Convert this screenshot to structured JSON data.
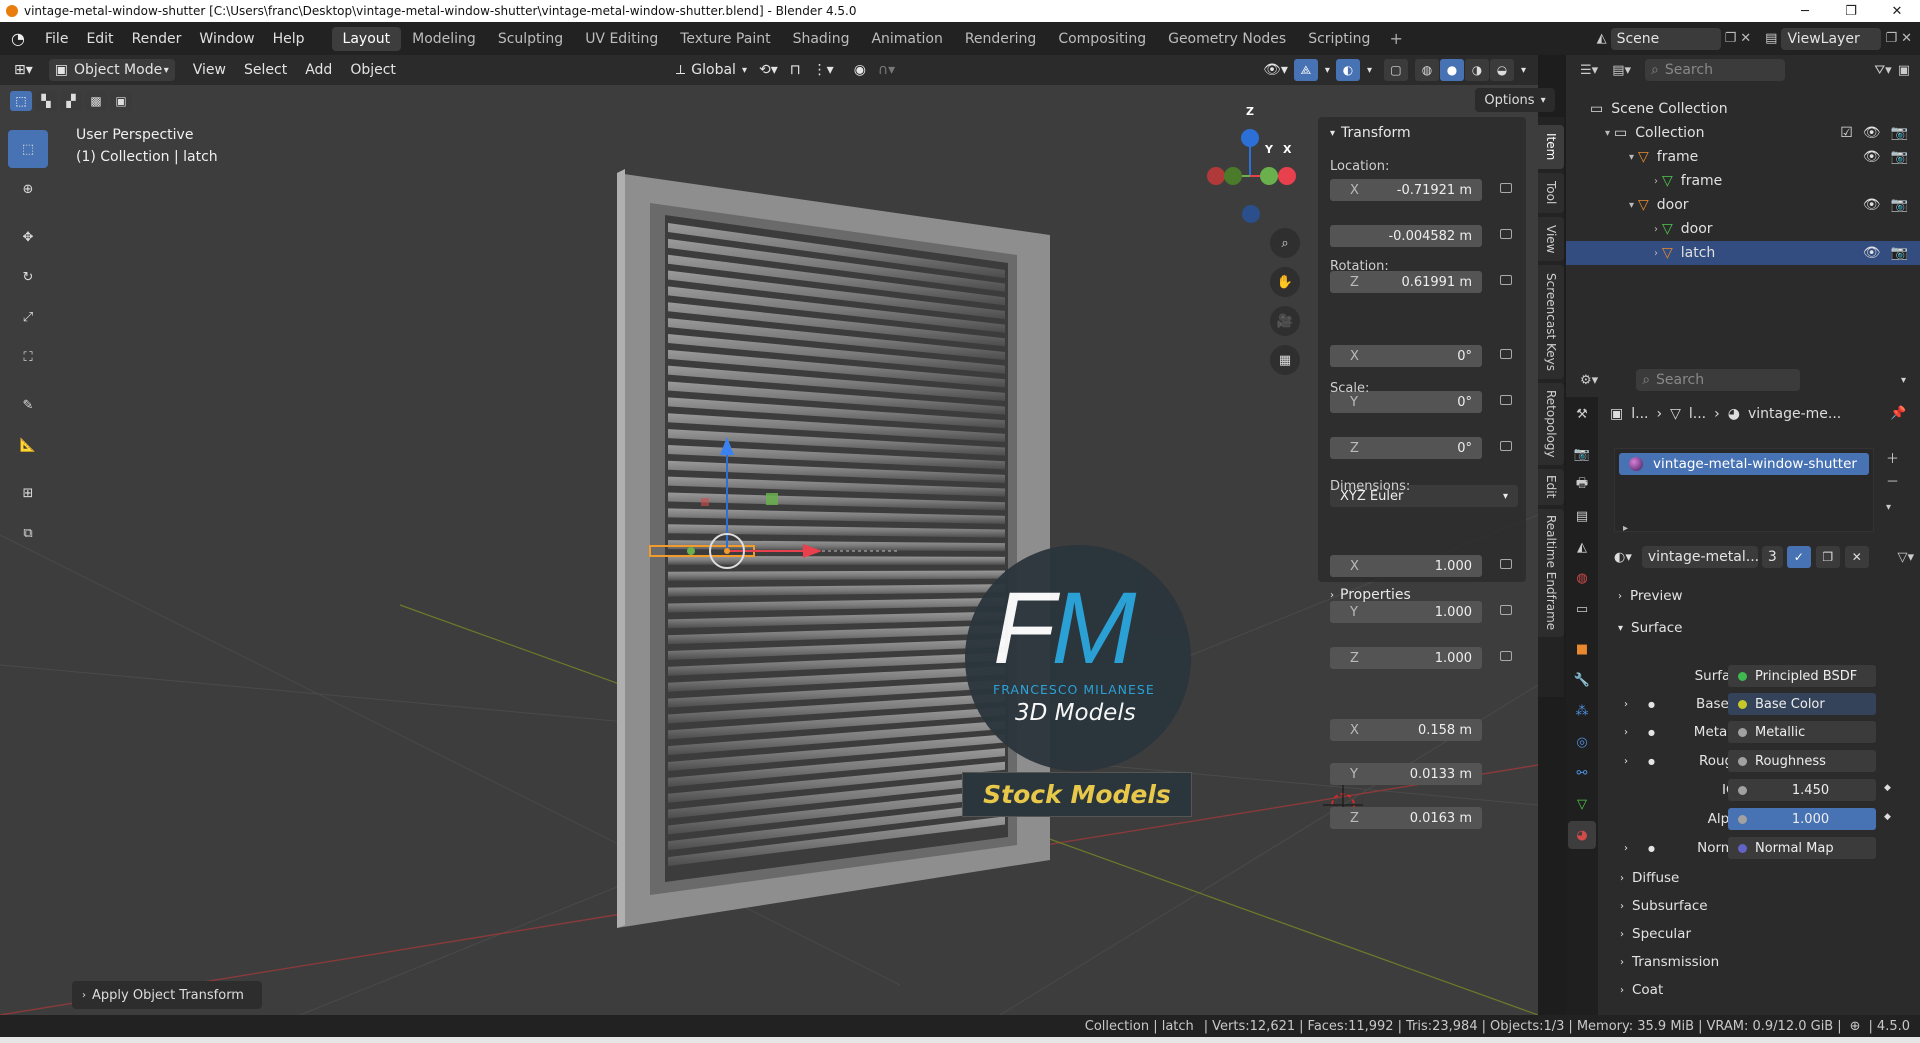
{
  "window": {
    "title": "vintage-metal-window-shutter [C:\\Users\\franc\\Desktop\\vintage-metal-window-shutter\\vintage-metal-window-shutter.blend] - Blender 4.5.0",
    "minimize_icon": "minimize-icon",
    "maximize_icon": "maximize-icon",
    "close_icon": "close-icon"
  },
  "menubar": {
    "menus": [
      "File",
      "Edit",
      "Render",
      "Window",
      "Help"
    ],
    "workspaces": [
      "Layout",
      "Modeling",
      "Sculpting",
      "UV Editing",
      "Texture Paint",
      "Shading",
      "Animation",
      "Rendering",
      "Compositing",
      "Geometry Nodes",
      "Scripting"
    ],
    "active_workspace": "Layout",
    "scene": "Scene",
    "view_layer": "ViewLayer"
  },
  "viewport_header": {
    "mode": "Object Mode",
    "menus": [
      "View",
      "Select",
      "Add",
      "Object"
    ],
    "orientation": "Global",
    "options_label": "Options"
  },
  "viewport": {
    "perspective_label": "User Perspective",
    "collection_label": "(1) Collection | latch",
    "watermark_logo": "FM",
    "watermark_name": "FRANCESCO MILANESE",
    "watermark_sub": "3D Models",
    "watermark_stock": "Stock Models",
    "last_operator": "Apply Object Transform",
    "gizmo_axes": {
      "x": "X",
      "y": "Y",
      "z": "Z"
    }
  },
  "npanel": {
    "section": "Transform",
    "location_label": "Location:",
    "location": [
      {
        "axis": "X",
        "value": "-0.71921 m"
      },
      {
        "axis": "",
        "value": "-0.004582 m"
      },
      {
        "axis": "Z",
        "value": "0.61991 m"
      }
    ],
    "rotation_label": "Rotation:",
    "rotation": [
      {
        "axis": "X",
        "value": "0°"
      },
      {
        "axis": "Y",
        "value": "0°"
      },
      {
        "axis": "Z",
        "value": "0°"
      }
    ],
    "rotation_mode": "XYZ Euler",
    "scale_label": "Scale:",
    "scale": [
      {
        "axis": "X",
        "value": "1.000"
      },
      {
        "axis": "Y",
        "value": "1.000"
      },
      {
        "axis": "Z",
        "value": "1.000"
      }
    ],
    "dimensions_label": "Dimensions:",
    "dimensions": [
      {
        "axis": "X",
        "value": "0.158 m"
      },
      {
        "axis": "Y",
        "value": "0.0133 m"
      },
      {
        "axis": "Z",
        "value": "0.0163 m"
      }
    ],
    "properties_section": "Properties",
    "tabs": [
      "Item",
      "Tool",
      "View",
      "Screencast Keys",
      "Retopology",
      "Edit",
      "Realtime Endframe"
    ]
  },
  "outliner": {
    "search_placeholder": "Search",
    "rows": [
      {
        "label": "Scene Collection",
        "indent": 0
      },
      {
        "label": "Collection",
        "indent": 1
      },
      {
        "label": "frame",
        "indent": 2
      },
      {
        "label": "frame",
        "indent": 3
      },
      {
        "label": "door",
        "indent": 2
      },
      {
        "label": "door",
        "indent": 3
      },
      {
        "label": "latch",
        "indent": 3
      }
    ],
    "selected": "latch"
  },
  "properties": {
    "search_placeholder": "Search",
    "breadcrumb": [
      "l...",
      "l...",
      "vintage-me..."
    ],
    "material_slot": "vintage-metal-window-shutter",
    "material_name": "vintage-metal...",
    "material_users": "3",
    "sections": {
      "preview": "Preview",
      "surface": "Surface"
    },
    "surface_rows": [
      {
        "label": "Surface",
        "value": "Principled BSDF",
        "socket": "#3fb950"
      },
      {
        "label": "Base ...",
        "value": "Base Color",
        "socket": "#c7c729"
      },
      {
        "label": "Metallic",
        "value": "Metallic",
        "socket": "#a1a1a1"
      },
      {
        "label": "Roug...",
        "value": "Roughness",
        "socket": "#a1a1a1"
      },
      {
        "label": "IOR",
        "value": "1.450",
        "socket": "#a1a1a1"
      },
      {
        "label": "Alpha",
        "value": "1.000",
        "socket": "#a1a1a1"
      },
      {
        "label": "Normal",
        "value": "Normal Map",
        "socket": "#6363c7"
      }
    ],
    "subsections": [
      "Diffuse",
      "Subsurface",
      "Specular",
      "Transmission",
      "Coat"
    ]
  },
  "statusbar": {
    "collection": "Collection | latch",
    "verts": "Verts:12,621",
    "faces": "Faces:11,992",
    "tris": "Tris:23,984",
    "objects": "Objects:1/3",
    "memory": "Memory: 35.9 MiB",
    "vram": "VRAM: 0.9/12.0 GiB",
    "version": "4.5.0"
  },
  "colors": {
    "accent": "#4772b3",
    "selection": "#334d80",
    "watermark_blue": "#2aa6de",
    "watermark_gold": "#e8c84a"
  }
}
